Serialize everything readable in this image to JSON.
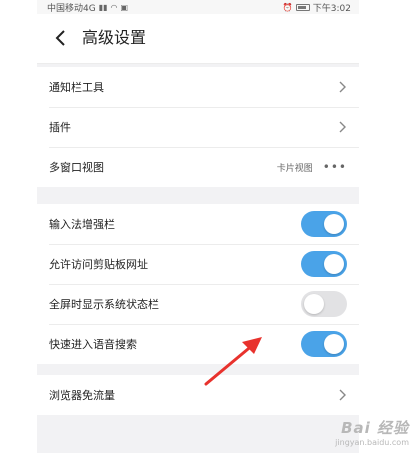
{
  "status_bar": {
    "carrier": "中国移动4G",
    "time": "下午3:02"
  },
  "header": {
    "title": "高级设置"
  },
  "group1": {
    "items": [
      {
        "label": "通知栏工具"
      },
      {
        "label": "插件"
      },
      {
        "label": "多窗口视图",
        "value": "卡片视图"
      }
    ]
  },
  "group2": {
    "items": [
      {
        "label": "输入法增强栏",
        "enabled": true
      },
      {
        "label": "允许访问剪贴板网址",
        "enabled": true
      },
      {
        "label": "全屏时显示系统状态栏",
        "enabled": false
      },
      {
        "label": "快速进入语音搜索",
        "enabled": true
      }
    ]
  },
  "group3": {
    "items": [
      {
        "label": "浏览器免流量"
      }
    ]
  },
  "colors": {
    "toggle_on": "#4aa3e8",
    "toggle_off": "#e2e2e4",
    "arrow": "#e8322d"
  },
  "watermark": {
    "main": "Bai 经验",
    "url": "jingyan.baidu.com"
  }
}
